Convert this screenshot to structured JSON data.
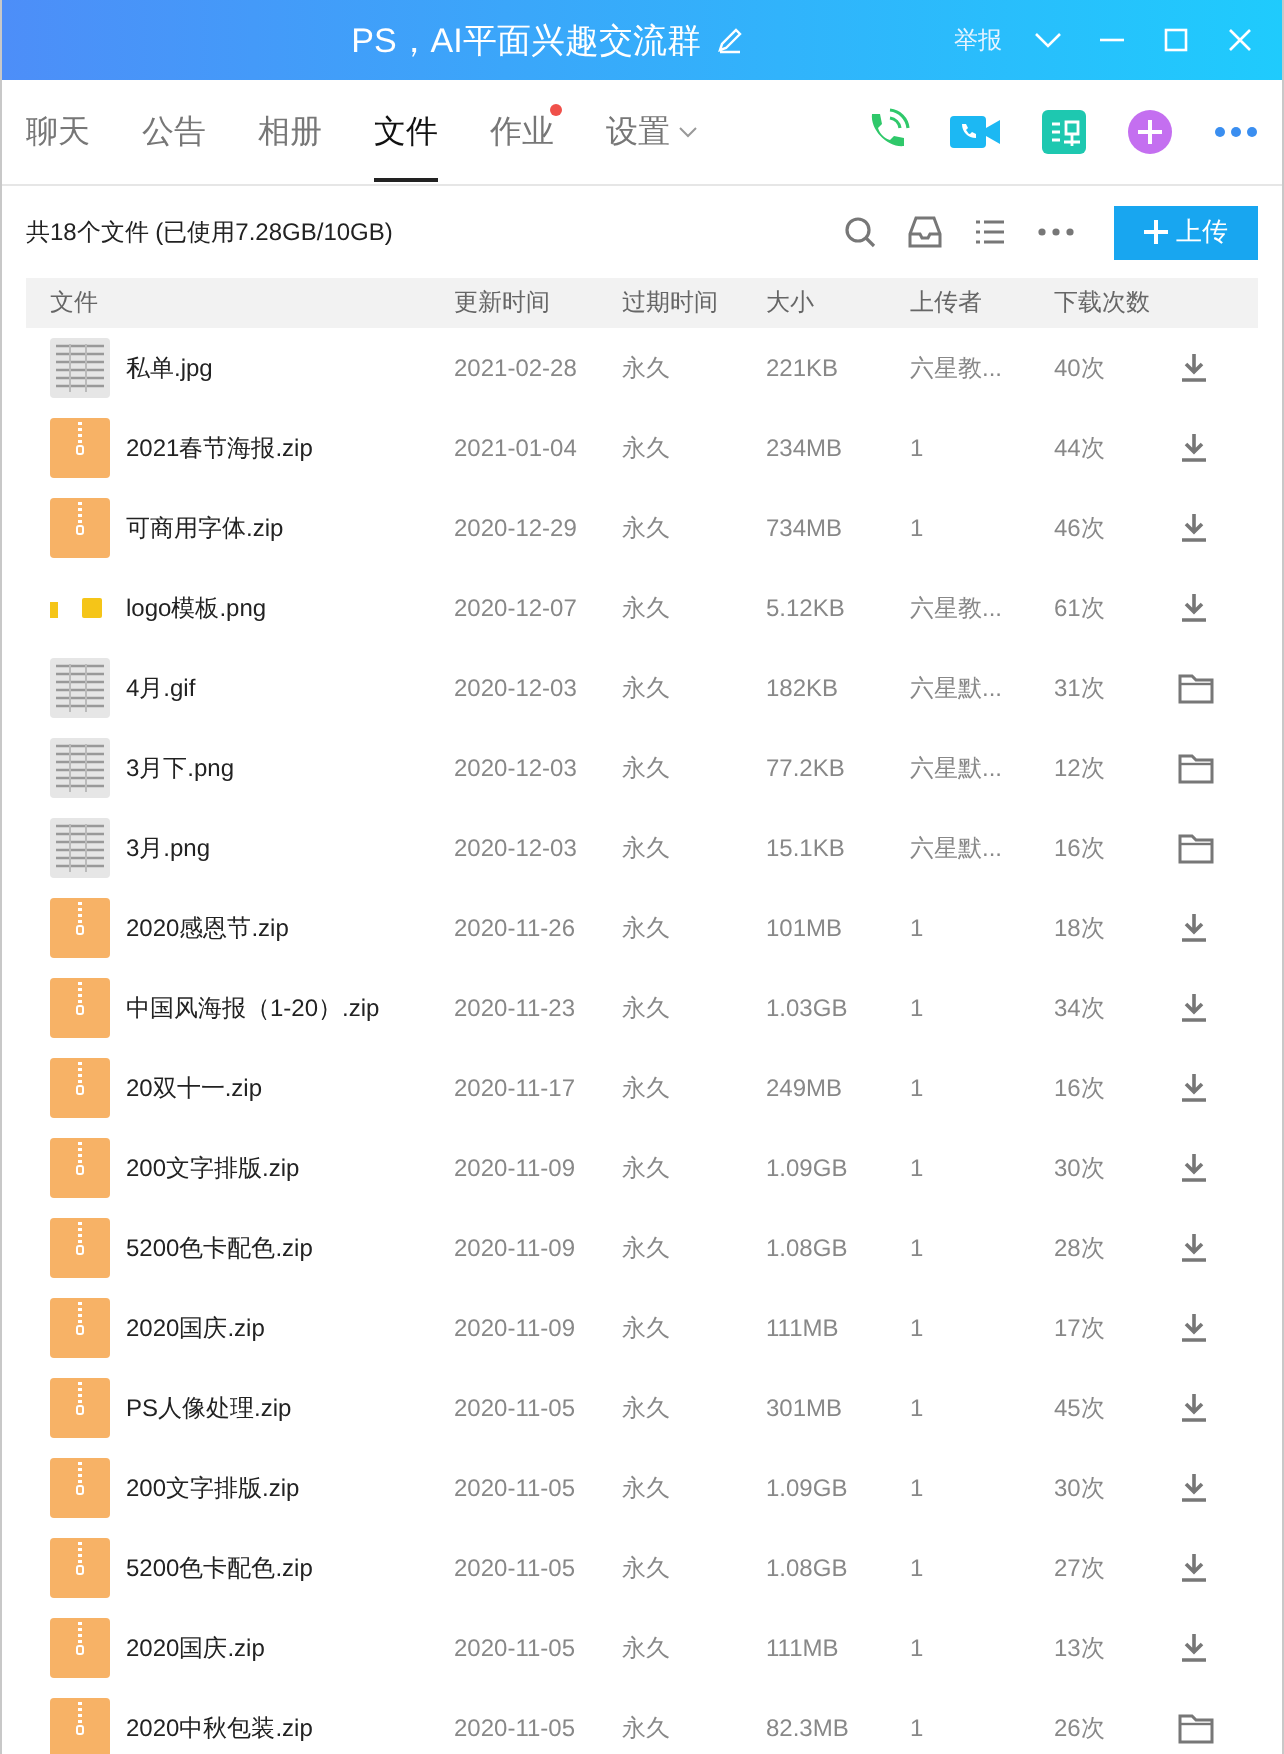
{
  "window": {
    "title": "PS，AI平面兴趣交流群",
    "report": "举报"
  },
  "tabs": [
    {
      "label": "聊天",
      "selected": false,
      "badge": false,
      "dropdown": false
    },
    {
      "label": "公告",
      "selected": false,
      "badge": false,
      "dropdown": false
    },
    {
      "label": "相册",
      "selected": false,
      "badge": false,
      "dropdown": false
    },
    {
      "label": "文件",
      "selected": true,
      "badge": false,
      "dropdown": false
    },
    {
      "label": "作业",
      "selected": false,
      "badge": true,
      "dropdown": false
    },
    {
      "label": "设置",
      "selected": false,
      "badge": false,
      "dropdown": true
    }
  ],
  "toolbar": {
    "summary": "共18个文件 (已使用7.28GB/10GB)",
    "upload": "上传"
  },
  "table": {
    "columns": [
      "文件",
      "更新时间",
      "过期时间",
      "大小",
      "上传者",
      "下载次数"
    ],
    "rows": [
      {
        "thumbnail": {
          "kind": "scan"
        },
        "name": "私单.jpg",
        "updated": "2021-02-28",
        "expiry": "永久",
        "size": "221KB",
        "uploader": "六星教...",
        "downloads": "40次",
        "action": {
          "kind": "download"
        }
      },
      {
        "thumbnail": {
          "kind": "zip"
        },
        "name": "2021春节海报.zip",
        "updated": "2021-01-04",
        "expiry": "永久",
        "size": "234MB",
        "uploader": "1",
        "downloads": "44次",
        "action": {
          "kind": "download"
        }
      },
      {
        "thumbnail": {
          "kind": "zip"
        },
        "name": "可商用字体.zip",
        "updated": "2020-12-29",
        "expiry": "永久",
        "size": "734MB",
        "uploader": "1",
        "downloads": "46次",
        "action": {
          "kind": "download"
        }
      },
      {
        "thumbnail": {
          "kind": "logo"
        },
        "name": "logo模板.png",
        "updated": "2020-12-07",
        "expiry": "永久",
        "size": "5.12KB",
        "uploader": "六星教...",
        "downloads": "61次",
        "action": {
          "kind": "download"
        }
      },
      {
        "thumbnail": {
          "kind": "scan"
        },
        "name": "4月.gif",
        "updated": "2020-12-03",
        "expiry": "永久",
        "size": "182KB",
        "uploader": "六星默...",
        "downloads": "31次",
        "action": {
          "kind": "folder"
        }
      },
      {
        "thumbnail": {
          "kind": "scan"
        },
        "name": "3月下.png",
        "updated": "2020-12-03",
        "expiry": "永久",
        "size": "77.2KB",
        "uploader": "六星默...",
        "downloads": "12次",
        "action": {
          "kind": "folder"
        }
      },
      {
        "thumbnail": {
          "kind": "scan"
        },
        "name": "3月.png",
        "updated": "2020-12-03",
        "expiry": "永久",
        "size": "15.1KB",
        "uploader": "六星默...",
        "downloads": "16次",
        "action": {
          "kind": "folder"
        }
      },
      {
        "thumbnail": {
          "kind": "zip"
        },
        "name": "2020感恩节.zip",
        "updated": "2020-11-26",
        "expiry": "永久",
        "size": "101MB",
        "uploader": "1",
        "downloads": "18次",
        "action": {
          "kind": "download"
        }
      },
      {
        "thumbnail": {
          "kind": "zip"
        },
        "name": "中国风海报（1-20）.zip",
        "updated": "2020-11-23",
        "expiry": "永久",
        "size": "1.03GB",
        "uploader": "1",
        "downloads": "34次",
        "action": {
          "kind": "download"
        }
      },
      {
        "thumbnail": {
          "kind": "zip"
        },
        "name": "20双十一.zip",
        "updated": "2020-11-17",
        "expiry": "永久",
        "size": "249MB",
        "uploader": "1",
        "downloads": "16次",
        "action": {
          "kind": "download"
        }
      },
      {
        "thumbnail": {
          "kind": "zip"
        },
        "name": "200文字排版.zip",
        "updated": "2020-11-09",
        "expiry": "永久",
        "size": "1.09GB",
        "uploader": "1",
        "downloads": "30次",
        "action": {
          "kind": "download"
        }
      },
      {
        "thumbnail": {
          "kind": "zip"
        },
        "name": "5200色卡配色.zip",
        "updated": "2020-11-09",
        "expiry": "永久",
        "size": "1.08GB",
        "uploader": "1",
        "downloads": "28次",
        "action": {
          "kind": "download"
        }
      },
      {
        "thumbnail": {
          "kind": "zip"
        },
        "name": "2020国庆.zip",
        "updated": "2020-11-09",
        "expiry": "永久",
        "size": "111MB",
        "uploader": "1",
        "downloads": "17次",
        "action": {
          "kind": "download"
        }
      },
      {
        "thumbnail": {
          "kind": "zip"
        },
        "name": "PS人像处理.zip",
        "updated": "2020-11-05",
        "expiry": "永久",
        "size": "301MB",
        "uploader": "1",
        "downloads": "45次",
        "action": {
          "kind": "download"
        }
      },
      {
        "thumbnail": {
          "kind": "zip"
        },
        "name": "200文字排版.zip",
        "updated": "2020-11-05",
        "expiry": "永久",
        "size": "1.09GB",
        "uploader": "1",
        "downloads": "30次",
        "action": {
          "kind": "download"
        }
      },
      {
        "thumbnail": {
          "kind": "zip"
        },
        "name": "5200色卡配色.zip",
        "updated": "2020-11-05",
        "expiry": "永久",
        "size": "1.08GB",
        "uploader": "1",
        "downloads": "27次",
        "action": {
          "kind": "download"
        }
      },
      {
        "thumbnail": {
          "kind": "zip"
        },
        "name": "2020国庆.zip",
        "updated": "2020-11-05",
        "expiry": "永久",
        "size": "111MB",
        "uploader": "1",
        "downloads": "13次",
        "action": {
          "kind": "download"
        }
      },
      {
        "thumbnail": {
          "kind": "zip"
        },
        "name": "2020中秋包装.zip",
        "updated": "2020-11-05",
        "expiry": "永久",
        "size": "82.3MB",
        "uploader": "1",
        "downloads": "26次",
        "action": {
          "kind": "folder"
        }
      }
    ]
  }
}
